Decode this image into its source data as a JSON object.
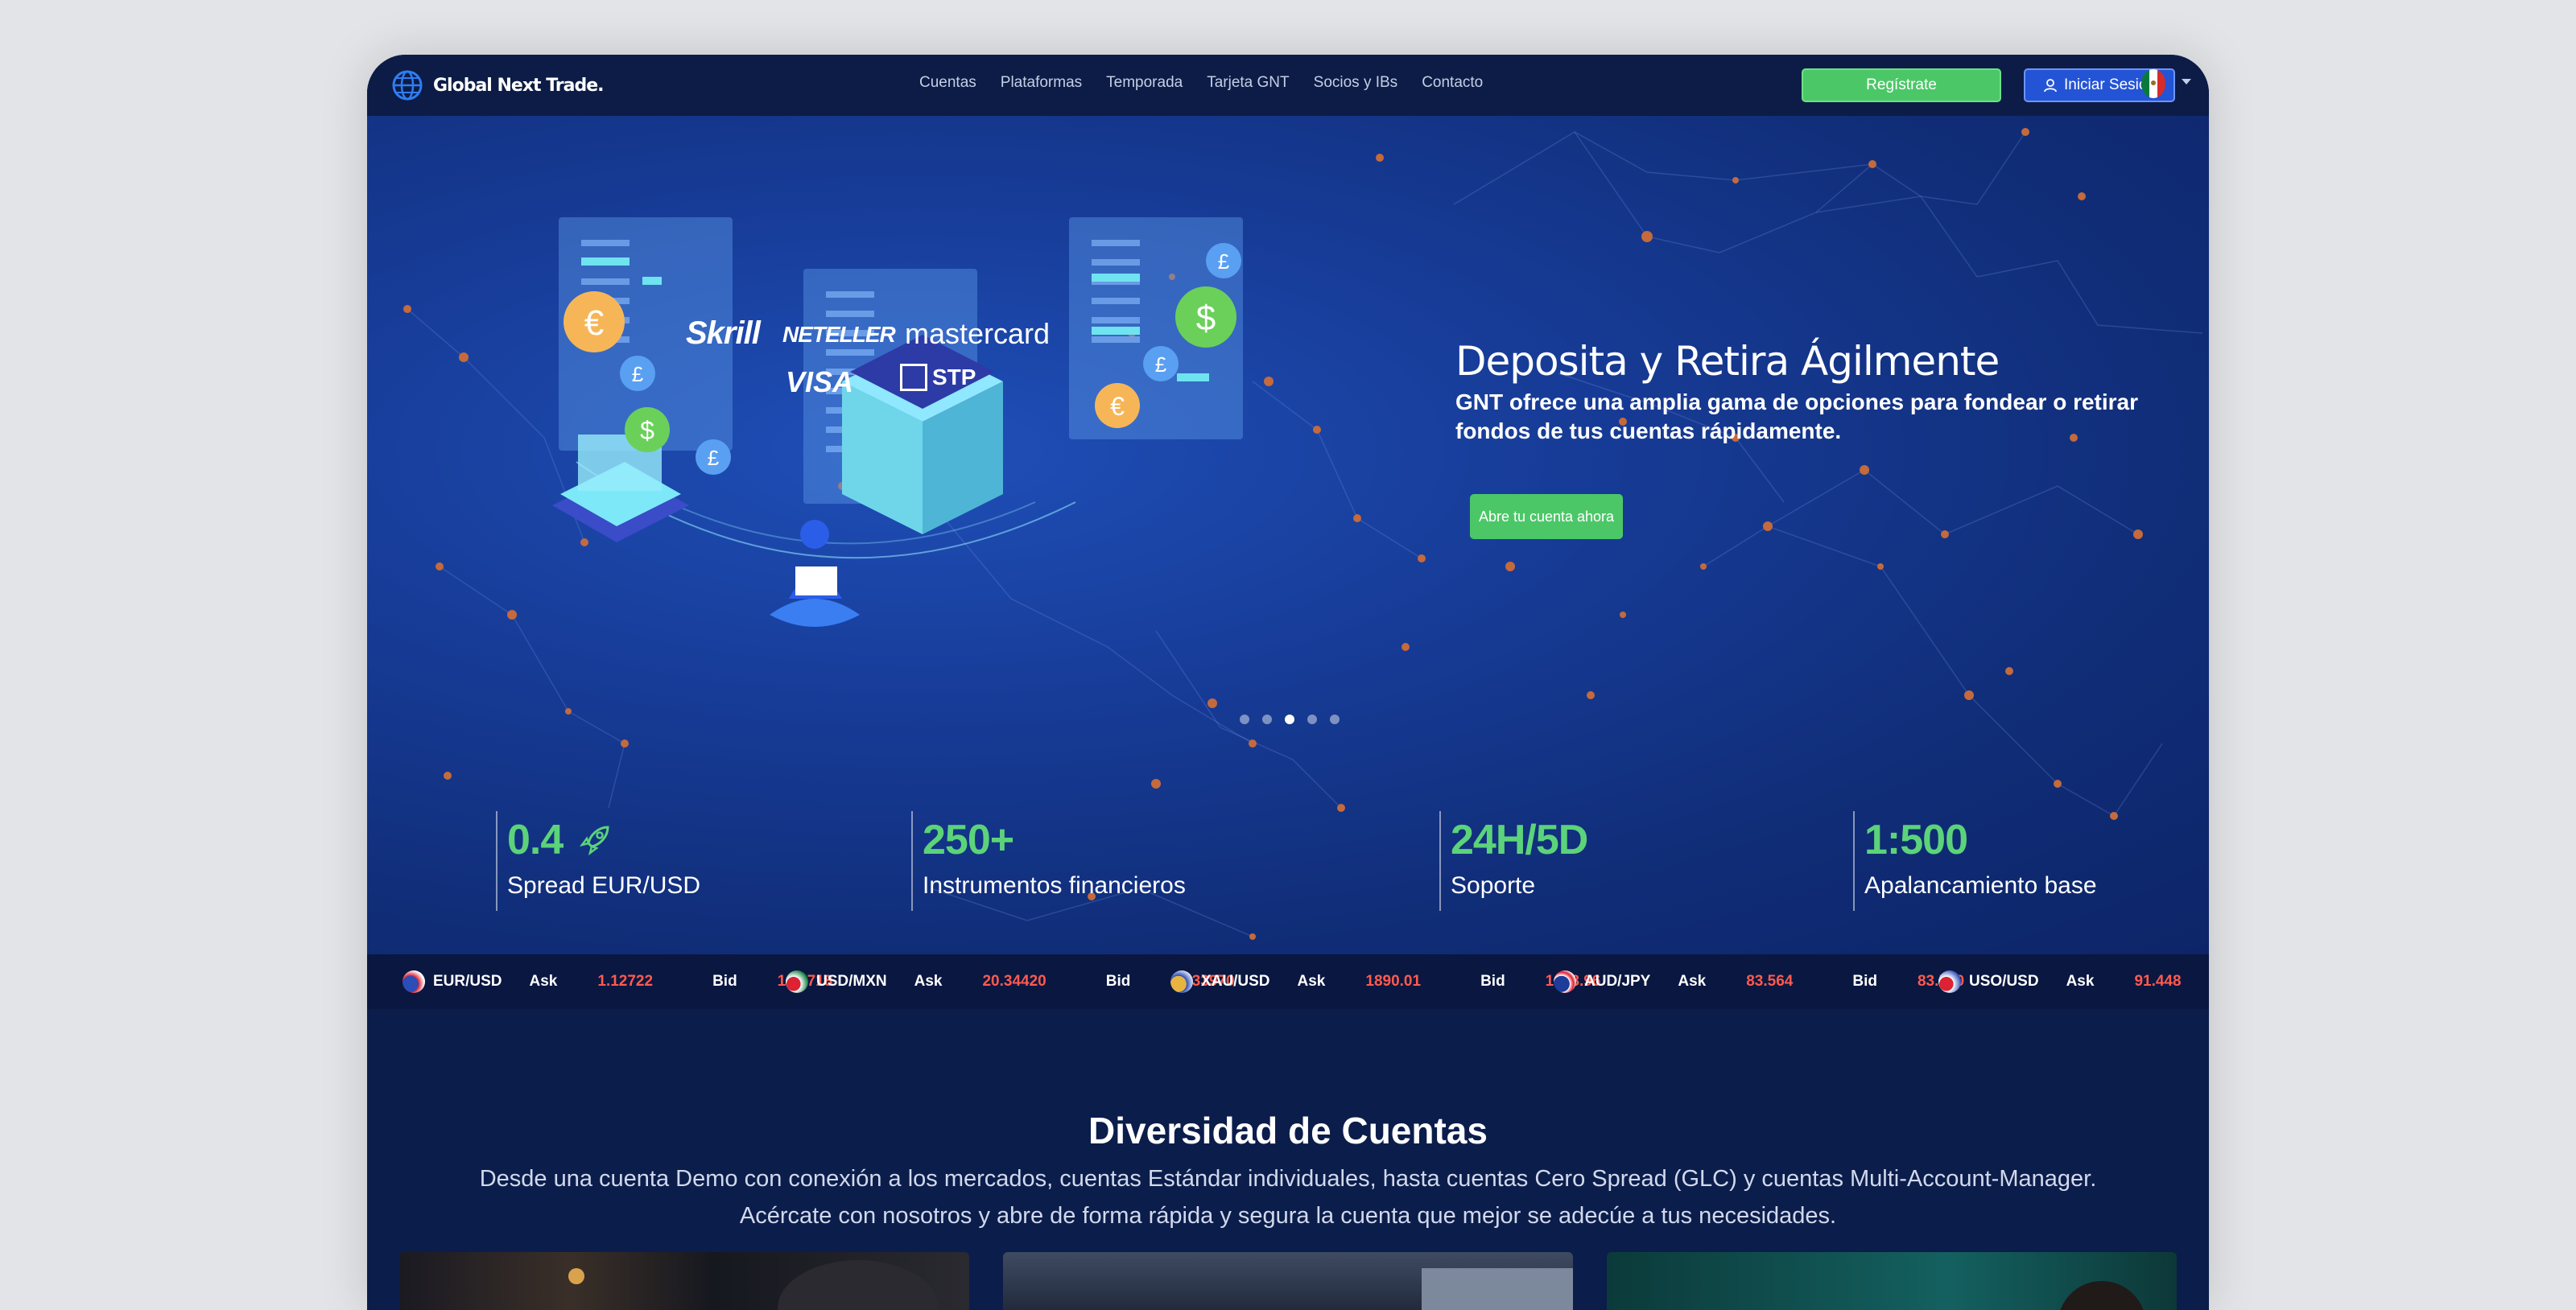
{
  "nav": {
    "logo_text": "Global Next Trade.",
    "links": [
      "Cuentas",
      "Plataformas",
      "Temporada",
      "Tarjeta GNT",
      "Socios y IBs",
      "Contacto"
    ],
    "register": "Regístrate",
    "login": "Iniciar Sesión"
  },
  "hero": {
    "title": "Deposita y Retira Ágilmente",
    "subtitle": "GNT ofrece una amplia gama de opciones para fondear o retirar fondos de tus cuentas rápidamente.",
    "cta": "Abre tu cuenta ahora",
    "payment_logos": [
      "Skrill",
      "NETELLER",
      "mastercard",
      "VISA",
      "STP"
    ],
    "slide_count": 5,
    "active_slide": 3
  },
  "stats": [
    {
      "value": "0.4",
      "label": "Spread EUR/USD",
      "icon": "rocket-icon"
    },
    {
      "value": "250+",
      "label": "Instrumentos financieros"
    },
    {
      "value": "24H/5D",
      "label": "Soporte"
    },
    {
      "value": "1:500",
      "label": "Apalancamiento base"
    }
  ],
  "ticker": {
    "ask_label": "Ask",
    "bid_label": "Bid",
    "items": [
      {
        "symbol": "EUR/USD",
        "ask": "1.12722",
        "bid": "1.12718"
      },
      {
        "symbol": "USD/MXN",
        "ask": "20.34420",
        "bid": "20.33970"
      },
      {
        "symbol": "XAU/USD",
        "ask": "1890.01",
        "bid": "1888.96"
      },
      {
        "symbol": "AUD/JPY",
        "ask": "83.564",
        "bid": "83.550"
      },
      {
        "symbol": "USO/USD",
        "ask": "91.448",
        "bid": ""
      }
    ]
  },
  "section": {
    "title": "Diversidad de Cuentas",
    "line1": "Desde una cuenta Demo con conexión a los mercados, cuentas Estándar individuales, hasta cuentas Cero Spread (GLC) y cuentas Multi-Account-Manager.",
    "line2": "Acércate con nosotros y abre de forma rápida y segura la cuenta que mejor se adecúe a tus necesidades."
  },
  "colors": {
    "accent_green": "#4cc768",
    "login_blue": "#2454d6",
    "ticker_red": "#ff5a4f",
    "navy": "#0b1d4b"
  }
}
